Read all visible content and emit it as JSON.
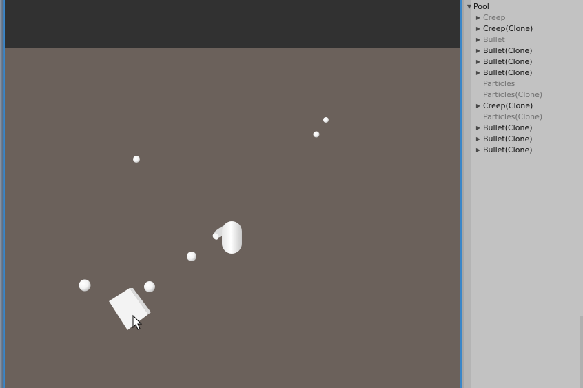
{
  "hierarchy": {
    "root": {
      "label": "Pool",
      "expanded": true
    },
    "items": [
      {
        "label": "Creep",
        "active": false,
        "has_children": true
      },
      {
        "label": "Creep(Clone)",
        "active": true,
        "has_children": true
      },
      {
        "label": "Bullet",
        "active": false,
        "has_children": true
      },
      {
        "label": "Bullet(Clone)",
        "active": true,
        "has_children": true
      },
      {
        "label": "Bullet(Clone)",
        "active": true,
        "has_children": true
      },
      {
        "label": "Bullet(Clone)",
        "active": true,
        "has_children": true
      },
      {
        "label": "Particles",
        "active": false,
        "has_children": false
      },
      {
        "label": "Particles(Clone)",
        "active": false,
        "has_children": false
      },
      {
        "label": "Creep(Clone)",
        "active": true,
        "has_children": true
      },
      {
        "label": "Particles(Clone)",
        "active": false,
        "has_children": false
      },
      {
        "label": "Bullet(Clone)",
        "active": true,
        "has_children": true
      },
      {
        "label": "Bullet(Clone)",
        "active": true,
        "has_children": true
      },
      {
        "label": "Bullet(Clone)",
        "active": true,
        "has_children": true
      }
    ]
  },
  "icons": {
    "expanded_arrow": "triangle-down-icon",
    "collapsed_arrow": "triangle-right-icon",
    "cursor": "mouse-pointer-icon"
  },
  "colors": {
    "game_background": "#6b615b",
    "game_toolbar": "#313131",
    "hierarchy_background": "#c2c2c2",
    "focus_border": "#3a86c8",
    "active_text": "#111111",
    "inactive_text": "#707070"
  }
}
